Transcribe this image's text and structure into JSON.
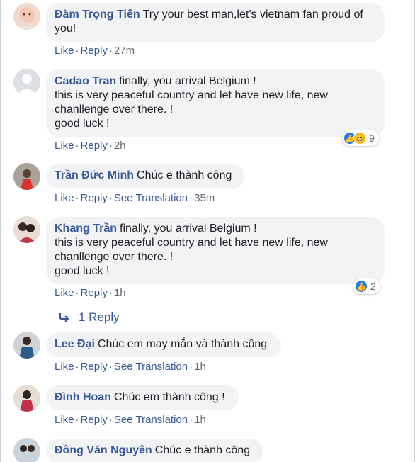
{
  "comments": [
    {
      "author": "Đàm Trọng Tiến",
      "text": "Try your best man,let’s vietnam fan proud of\nyou!",
      "actions": {
        "like": "Like",
        "reply": "Reply",
        "time": "27m"
      }
    },
    {
      "author": "Cadao Tran",
      "text": "finally, you arrival Belgium !\nthis is very peaceful country and let have new life, new\nchanllenge over there. !\ngood luck !",
      "actions": {
        "like": "Like",
        "reply": "Reply",
        "time": "2h"
      },
      "reactions": {
        "icons": [
          "like-icon",
          "haha-icon"
        ],
        "count": "9"
      }
    },
    {
      "author": "Trần Đức Minh",
      "text": "Chúc e thành công",
      "actions": {
        "like": "Like",
        "reply": "Reply",
        "translation": "See Translation",
        "time": "35m"
      }
    },
    {
      "author": "Khang Trần",
      "text": "finally, you arrival Belgium !\nthis is very peaceful country and let have new life, new\nchanllenge over there. !\ngood luck !",
      "actions": {
        "like": "Like",
        "reply": "Reply",
        "time": "1h"
      },
      "reactions": {
        "icons": [
          "like-icon"
        ],
        "count": "2"
      },
      "replies_label": "1 Reply"
    },
    {
      "author": "Lee Đại",
      "text": "Chúc em may mắn và thành công",
      "actions": {
        "like": "Like",
        "reply": "Reply",
        "translation": "See Translation",
        "time": "1h"
      }
    },
    {
      "author": "Đình Hoan",
      "text": "Chúc em thành công !",
      "actions": {
        "like": "Like",
        "reply": "Reply",
        "translation": "See Translation",
        "time": "1h"
      }
    },
    {
      "author": "Đồng Văn Nguyên",
      "text": "Chúc e thành công"
    }
  ],
  "colors": {
    "link": "#385898",
    "bubble": "#f2f3f5",
    "like": "#2078f4",
    "haha": "#f7b125"
  }
}
